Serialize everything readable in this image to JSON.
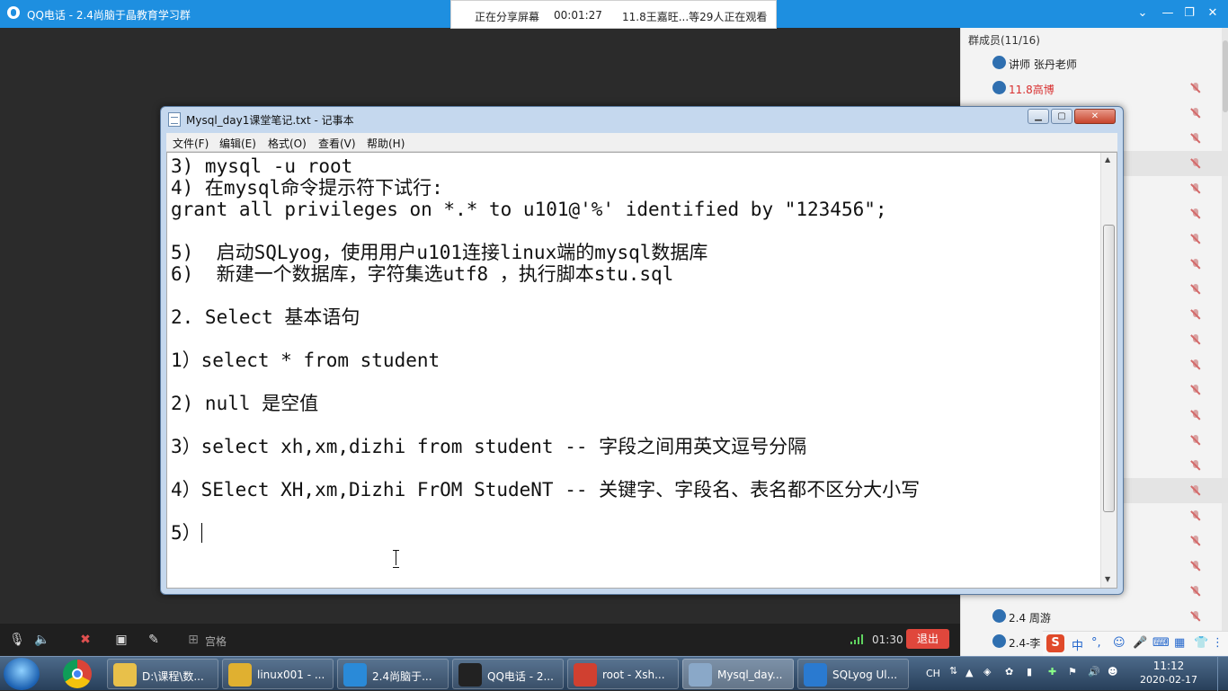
{
  "qq_window": {
    "title": "QQ电话 - 2.4尚脑于晶教育学习群"
  },
  "share_banner": {
    "status": "正在分享屏幕",
    "timer": "00:01:27",
    "viewers": "11.8王嘉旺...等29人正在观看"
  },
  "members": {
    "header": "群成员(11/16)",
    "top": [
      {
        "name": "讲师 张丹老师",
        "color": "#222222"
      },
      {
        "name": "11.8高博",
        "color": "#d83030"
      }
    ],
    "bottom": [
      {
        "name": "2.4 周游"
      },
      {
        "name": "2.4-李"
      }
    ]
  },
  "notepad": {
    "title": "Mysql_day1课堂笔记.txt - 记事本",
    "menu": [
      "文件(F)",
      "编辑(E)",
      "格式(O)",
      "查看(V)",
      "帮助(H)"
    ],
    "lines": [
      "3) mysql -u root",
      "4) 在mysql命令提示符下试行:",
      "grant all privileges on *.* to u101@'%' identified by \"123456\";",
      "",
      "5)  启动SQLyog，使用用户u101连接linux端的mysql数据库",
      "6)  新建一个数据库，字符集选utf8 ，执行脚本stu.sql",
      "",
      "2. Select 基本语句",
      "",
      "1）select * from student",
      "",
      "2) null 是空值",
      "",
      "3）select xh,xm,dizhi from student -- 字段之间用英文逗号分隔",
      "",
      "4）SElect XH,xm,Dizhi FrOM StudeNT -- 关键字、字段名、表名都不区分大小写",
      ""
    ],
    "last_line": "5）"
  },
  "toolbar": {
    "grid_label": "宫格",
    "duration": "01:30",
    "exit_label": "退出"
  },
  "taskbar": {
    "tasks": [
      {
        "label": "D:\\课程\\数...",
        "icon_color": "#e8c04a"
      },
      {
        "label": "linux001 - ...",
        "icon_color": "#e0b030"
      },
      {
        "label": "2.4尚脑于...",
        "icon_color": "#2a8ad8"
      },
      {
        "label": "QQ电话 - 2...",
        "icon_color": "#222222"
      },
      {
        "label": "root - Xsh...",
        "icon_color": "#d04030"
      },
      {
        "label": "Mysql_day...",
        "icon_color": "#8aa8c8"
      },
      {
        "label": "SQLyog Ul...",
        "icon_color": "#2a7ad0"
      }
    ],
    "lang": "CH",
    "time": "11:12",
    "date": "2020-02-17"
  },
  "ime": {
    "mode": "中"
  }
}
